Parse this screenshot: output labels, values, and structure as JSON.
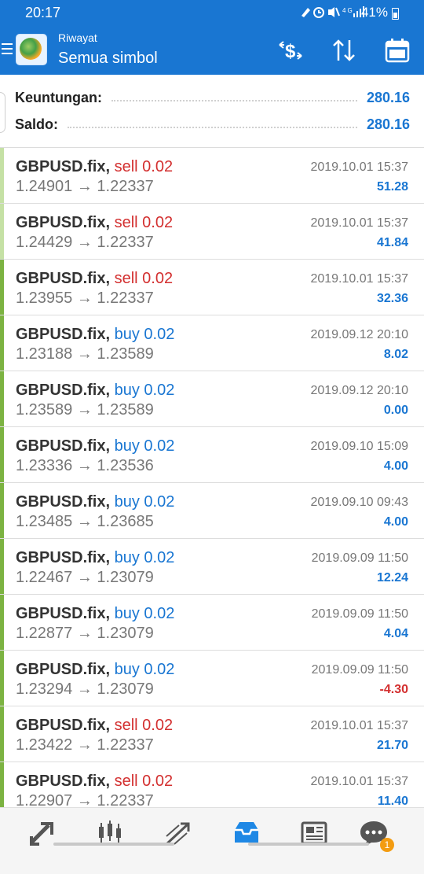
{
  "status_bar": {
    "time": "20:17",
    "battery": "41%",
    "icons": [
      "edit-icon",
      "alarm-icon",
      "mute-icon",
      "signal-4g-icon",
      "signal-icon"
    ]
  },
  "header": {
    "subtitle": "Riwayat",
    "title": "Semua simbol",
    "actions": [
      "currency-filter-icon",
      "sort-icon",
      "calendar-icon"
    ]
  },
  "summary": {
    "profit_label": "Keuntungan:",
    "profit_value": "280.16",
    "balance_label": "Saldo:",
    "balance_value": "280.16"
  },
  "trades": [
    {
      "symbol": "GBPUSD.fix,",
      "type": "sell",
      "lot": "0.02",
      "type_text": "sell 0.02",
      "open": "1.24901",
      "close": "1.22337",
      "arrow": "→",
      "date": "2019.10.01 15:37",
      "profit": "51.28"
    },
    {
      "symbol": "GBPUSD.fix,",
      "type": "sell",
      "lot": "0.02",
      "type_text": "sell 0.02",
      "open": "1.24429",
      "close": "1.22337",
      "arrow": "→",
      "date": "2019.10.01 15:37",
      "profit": "41.84"
    },
    {
      "symbol": "GBPUSD.fix,",
      "type": "sell",
      "lot": "0.02",
      "type_text": "sell 0.02",
      "open": "1.23955",
      "close": "1.22337",
      "arrow": "→",
      "date": "2019.10.01 15:37",
      "profit": "32.36"
    },
    {
      "symbol": "GBPUSD.fix,",
      "type": "buy",
      "lot": "0.02",
      "type_text": "buy 0.02",
      "open": "1.23188",
      "close": "1.23589",
      "arrow": "→",
      "date": "2019.09.12 20:10",
      "profit": "8.02"
    },
    {
      "symbol": "GBPUSD.fix,",
      "type": "buy",
      "lot": "0.02",
      "type_text": "buy 0.02",
      "open": "1.23589",
      "close": "1.23589",
      "arrow": "→",
      "date": "2019.09.12 20:10",
      "profit": "0.00"
    },
    {
      "symbol": "GBPUSD.fix,",
      "type": "buy",
      "lot": "0.02",
      "type_text": "buy 0.02",
      "open": "1.23336",
      "close": "1.23536",
      "arrow": "→",
      "date": "2019.09.10 15:09",
      "profit": "4.00"
    },
    {
      "symbol": "GBPUSD.fix,",
      "type": "buy",
      "lot": "0.02",
      "type_text": "buy 0.02",
      "open": "1.23485",
      "close": "1.23685",
      "arrow": "→",
      "date": "2019.09.10 09:43",
      "profit": "4.00"
    },
    {
      "symbol": "GBPUSD.fix,",
      "type": "buy",
      "lot": "0.02",
      "type_text": "buy 0.02",
      "open": "1.22467",
      "close": "1.23079",
      "arrow": "→",
      "date": "2019.09.09 11:50",
      "profit": "12.24"
    },
    {
      "symbol": "GBPUSD.fix,",
      "type": "buy",
      "lot": "0.02",
      "type_text": "buy 0.02",
      "open": "1.22877",
      "close": "1.23079",
      "arrow": "→",
      "date": "2019.09.09 11:50",
      "profit": "4.04"
    },
    {
      "symbol": "GBPUSD.fix,",
      "type": "buy",
      "lot": "0.02",
      "type_text": "buy 0.02",
      "open": "1.23294",
      "close": "1.23079",
      "arrow": "→",
      "date": "2019.09.09 11:50",
      "profit": "-4.30"
    },
    {
      "symbol": "GBPUSD.fix,",
      "type": "sell",
      "lot": "0.02",
      "type_text": "sell 0.02",
      "open": "1.23422",
      "close": "1.22337",
      "arrow": "→",
      "date": "2019.10.01 15:37",
      "profit": "21.70"
    },
    {
      "symbol": "GBPUSD.fix,",
      "type": "sell",
      "lot": "0.02",
      "type_text": "sell 0.02",
      "open": "1.22907",
      "close": "1.22337",
      "arrow": "→",
      "date": "2019.10.01 15:37",
      "profit": "11.40"
    }
  ],
  "bottom_nav": {
    "items": [
      "quotes-icon",
      "chart-icon",
      "trade-icon",
      "history-icon",
      "news-icon",
      "messages-icon"
    ],
    "active": "history-icon",
    "messages_badge": "1"
  },
  "colors": {
    "primary": "#1976d2",
    "sell": "#d32f2f",
    "buy": "#1976d2",
    "edge_green": "#7cb342"
  }
}
